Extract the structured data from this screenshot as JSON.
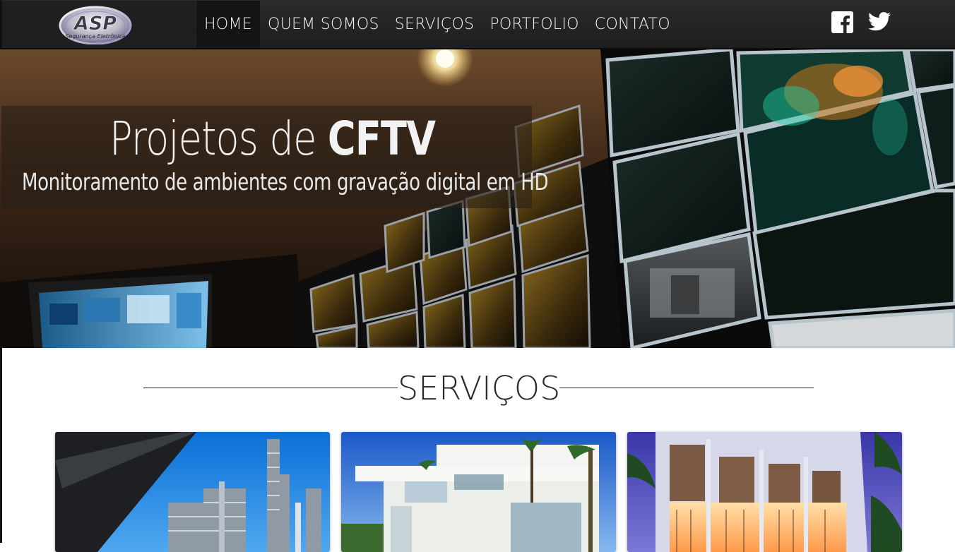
{
  "brand": {
    "logo_text": "ASP",
    "logo_tagline": "Segurança Eletrônica"
  },
  "nav": {
    "items": [
      {
        "label": "HOME",
        "active": true
      },
      {
        "label": "QUEM SOMOS",
        "active": false
      },
      {
        "label": "SERVIÇOS",
        "active": false
      },
      {
        "label": "PORTFOLIO",
        "active": false
      },
      {
        "label": "CONTATO",
        "active": false
      }
    ],
    "social": [
      {
        "icon": "facebook-icon"
      },
      {
        "icon": "twitter-icon"
      }
    ]
  },
  "hero": {
    "title_light": "Projetos de ",
    "title_bold": "CFTV",
    "subtitle": "Monitoramento de ambientes com gravação digital em HD"
  },
  "services": {
    "heading": "SERVIÇOS",
    "cards": [
      {
        "image": "industrial-plant-photo"
      },
      {
        "image": "white-residence-photo"
      },
      {
        "image": "commercial-building-photo"
      }
    ]
  },
  "colors": {
    "navbar_bg": "#252525",
    "nav_active_bg": "#141414",
    "nav_text": "#f4f4f4",
    "heading_text": "#2a2a2a"
  }
}
